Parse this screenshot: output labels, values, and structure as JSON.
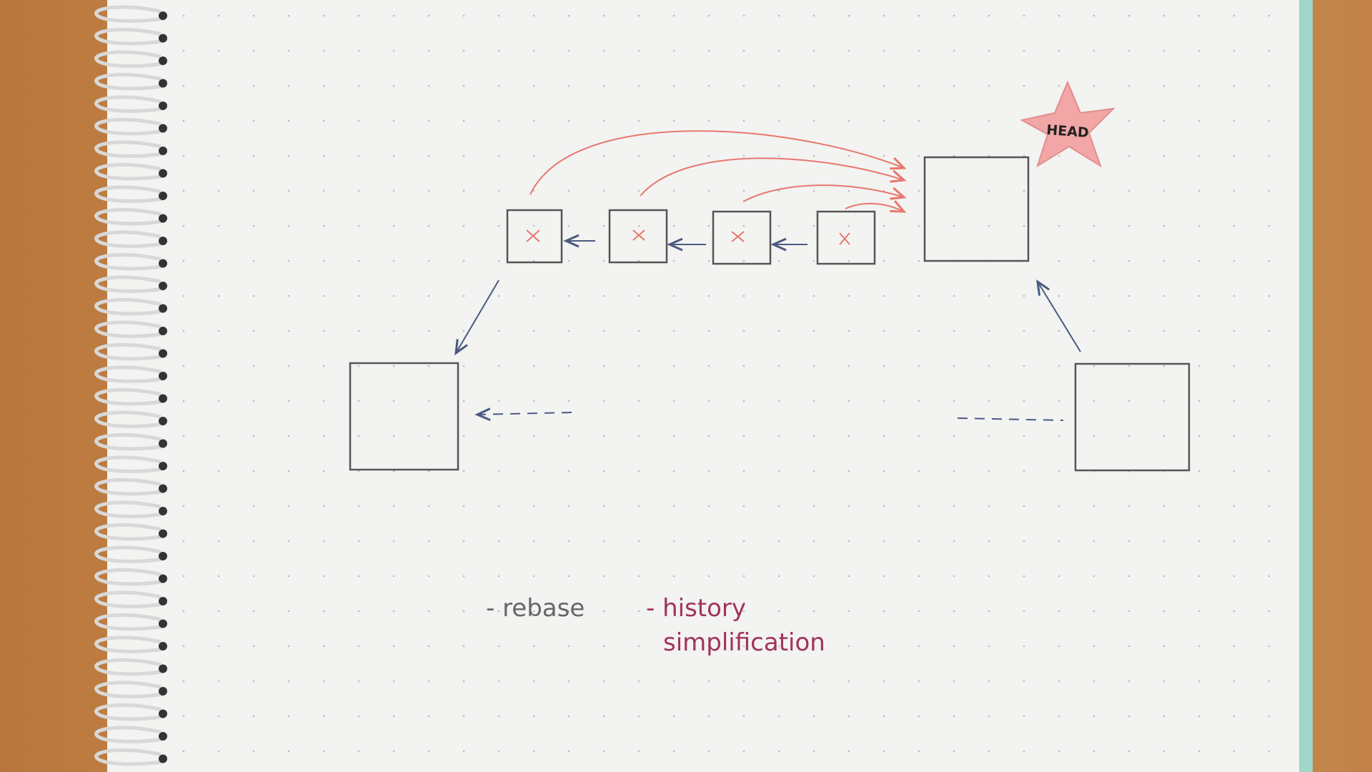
{
  "diagram": {
    "head_label": "HEAD",
    "notes": {
      "rebase": "- rebase",
      "history_line1": "- history",
      "history_line2": "simplification"
    },
    "commits": [
      {
        "id": "c1",
        "marked": "x"
      },
      {
        "id": "c2",
        "marked": "x"
      },
      {
        "id": "c3",
        "marked": "x"
      },
      {
        "id": "c4",
        "marked": "x"
      }
    ],
    "colors": {
      "ink": "#555555",
      "blue_ink": "#4a5a80",
      "red_ink": "#e8776f",
      "star": "#f2a6a6",
      "note_red": "#a0345a",
      "paper": "#f4f4f2",
      "wood": "#c98a4e"
    }
  }
}
